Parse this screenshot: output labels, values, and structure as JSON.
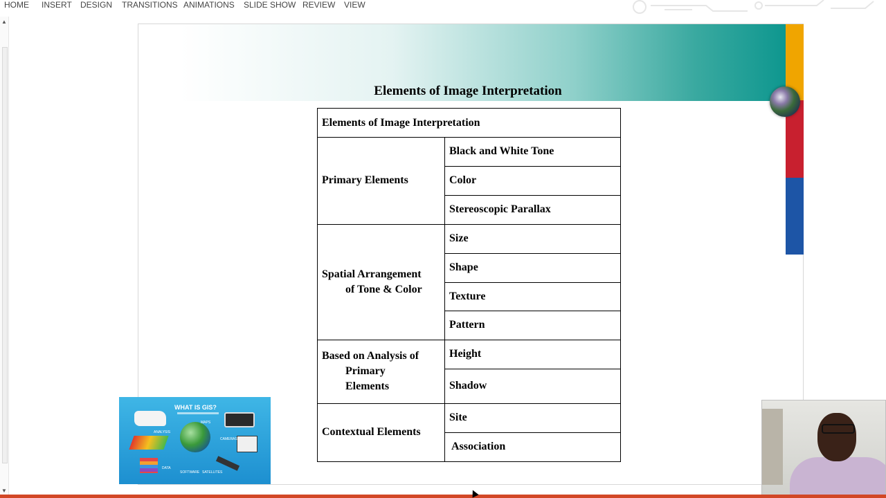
{
  "ribbon": {
    "tabs": [
      "HOME",
      "INSERT",
      "DESIGN",
      "TRANSITIONS",
      "ANIMATIONS",
      "SLIDE SHOW",
      "REVIEW",
      "VIEW"
    ]
  },
  "slide": {
    "title": "Elements of Image Interpretation",
    "table": {
      "header": "Elements of Image Interpretation",
      "groups": [
        {
          "category": "Primary Elements",
          "items": [
            "Black and White Tone",
            "Color",
            "Stereoscopic Parallax"
          ]
        },
        {
          "category_line1": "Spatial Arrangement",
          "category_line2": "of Tone & Color",
          "items": [
            "Size",
            "Shape",
            "Texture",
            "Pattern"
          ]
        },
        {
          "category_line1": "Based on Analysis of",
          "category_line2": "Primary",
          "category_line3": "Elements",
          "items": [
            "Height",
            "Shadow"
          ]
        },
        {
          "category": "Contextual Elements",
          "items": [
            "Site",
            "Association"
          ]
        }
      ]
    }
  },
  "thumbnail": {
    "title": "WHAT IS GIS?",
    "labels": [
      "MAPS",
      "ANALYSIS",
      "CAMERAS",
      "DATA",
      "SOFTWARE",
      "SATELLITES"
    ]
  },
  "colors": {
    "banner_teal": "#0e978f",
    "accent_orange": "#f0a500",
    "accent_red": "#c8202f",
    "accent_blue": "#1d55a6"
  }
}
